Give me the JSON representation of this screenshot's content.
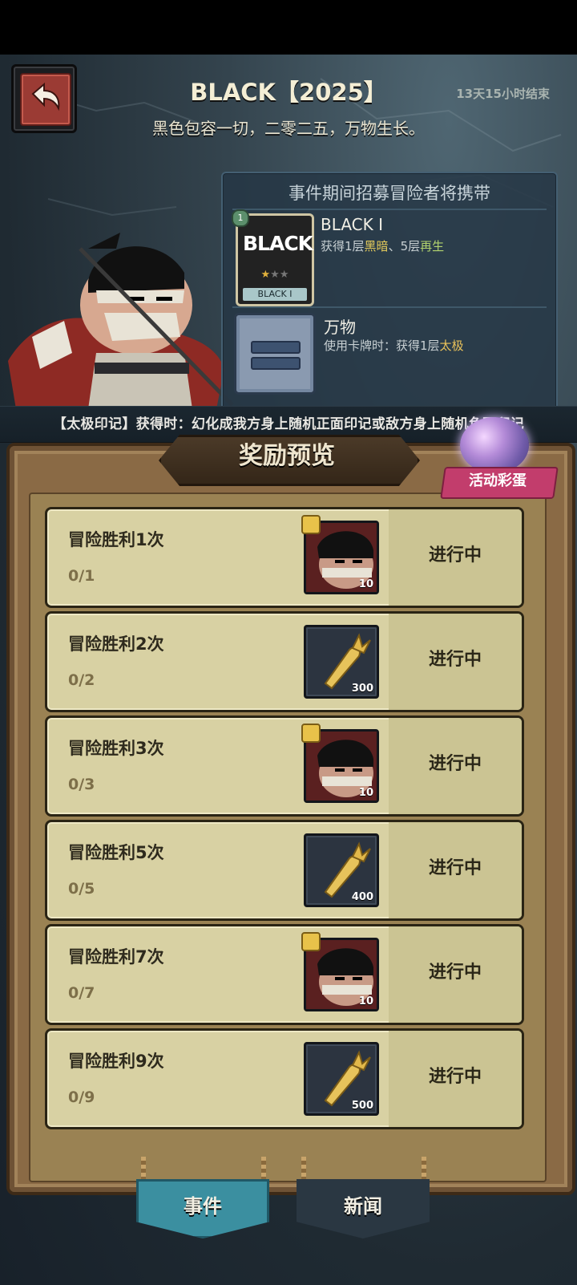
{
  "header": {
    "title": "BLACK【2025】",
    "subtitle": "黑色包容一切，二零二五，万物生长。",
    "timer": "13天15小时结束"
  },
  "panel": {
    "heading": "事件期间招募冒险者将携带",
    "card": {
      "art_text": "BLACK",
      "label": "BLACK I",
      "badge": "1",
      "name": "BLACK I",
      "desc_pre": "获得1层",
      "desc_k1": "黑暗",
      "desc_mid": "、5层",
      "desc_k2": "再生"
    },
    "relic": {
      "name": "万物",
      "desc_pre": "使用卡牌时：获得1层",
      "desc_k": "太极"
    }
  },
  "banner": "【太极印记】获得时：幻化成我方身上随机正面印记或敌方身上随机负面印记",
  "rewards": {
    "title": "奖励预览",
    "egg_label": "活动彩蛋"
  },
  "tasks": [
    {
      "name": "冒险胜利1次",
      "progress": "0/1",
      "status": "进行中",
      "reward": "hero-portrait",
      "qty": "10"
    },
    {
      "name": "冒险胜利2次",
      "progress": "0/2",
      "status": "进行中",
      "reward": "carrot",
      "qty": "300"
    },
    {
      "name": "冒险胜利3次",
      "progress": "0/3",
      "status": "进行中",
      "reward": "hero-portrait",
      "qty": "10"
    },
    {
      "name": "冒险胜利5次",
      "progress": "0/5",
      "status": "进行中",
      "reward": "carrot",
      "qty": "400"
    },
    {
      "name": "冒险胜利7次",
      "progress": "0/7",
      "status": "进行中",
      "reward": "hero-portrait",
      "qty": "10"
    },
    {
      "name": "冒险胜利9次",
      "progress": "0/9",
      "status": "进行中",
      "reward": "carrot",
      "qty": "500"
    }
  ],
  "tabs": [
    {
      "label": "事件",
      "active": true
    },
    {
      "label": "新闻",
      "active": false
    }
  ],
  "colors": {
    "accent_yellow": "#e6cc5b",
    "accent_green": "#b2d36e",
    "task_bg": "#d8d1a3",
    "active_tab": "#3b8fa0",
    "inactive_tab": "#2a3742"
  }
}
